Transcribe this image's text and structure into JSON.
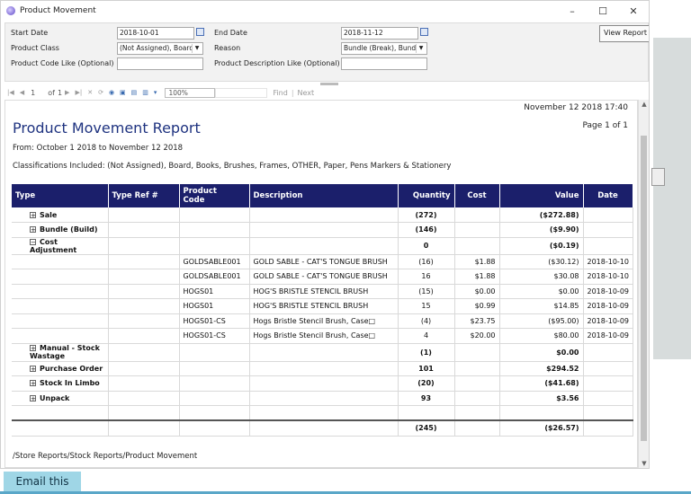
{
  "window": {
    "title": "Product Movement",
    "controls": {
      "minimize": "–",
      "maximize": "☐",
      "close": "✕"
    }
  },
  "params": {
    "start_date_label": "Start Date",
    "start_date_value": "2018-10-01",
    "end_date_label": "End Date",
    "end_date_value": "2018-11-12",
    "product_class_label": "Product Class",
    "product_class_value": "(Not Assigned), Board",
    "reason_label": "Reason",
    "reason_value": "Bundle (Break), Bundl",
    "code_like_label": "Product Code Like (Optional)",
    "code_like_value": "",
    "desc_like_label": "Product Description Like (Optional)",
    "desc_like_value": "",
    "view_report_label": "View Report"
  },
  "toolbar": {
    "page_current": "1",
    "page_of": "of",
    "page_total": "1",
    "zoom": "100%",
    "find_label": "Find",
    "separator": "|",
    "next_label": "Next"
  },
  "report": {
    "run_datetime": "November 12 2018 17:40",
    "title": "Product Movement Report",
    "page_info": "Page 1 of 1",
    "from_line": "From: October 1 2018 to November 12 2018",
    "classifications": "Classifications Included: (Not Assigned), Board, Books, Brushes, Frames, OTHER, Paper, Pens Markers & Stationery",
    "columns": {
      "type": "Type",
      "type_ref": "Type Ref #",
      "product_code_1": "Product",
      "product_code_2": "Code",
      "description": "Description",
      "quantity": "Quantity",
      "cost": "Cost",
      "value": "Value",
      "date": "Date"
    },
    "rows": [
      {
        "type": "Sale",
        "expander": "+",
        "qty": "(272)",
        "value": "($272.88)"
      },
      {
        "type": "Bundle (Build)",
        "expander": "+",
        "qty": "(146)",
        "value": "($9.90)"
      },
      {
        "type": "Cost Adjustment",
        "expander": "−",
        "qty": "0",
        "value": "($0.19)"
      },
      {
        "code": "GOLDSABLE001",
        "desc": "GOLD SABLE - CAT'S TONGUE BRUSH",
        "qty": "(16)",
        "cost": "$1.88",
        "value": "($30.12)",
        "date": "2018-10-10"
      },
      {
        "code": "GOLDSABLE001",
        "desc": "GOLD SABLE - CAT'S TONGUE BRUSH",
        "qty": "16",
        "cost": "$1.88",
        "value": "$30.08",
        "date": "2018-10-10"
      },
      {
        "code": "HOGS01",
        "desc": "HOG'S BRISTLE STENCIL BRUSH",
        "qty": "(15)",
        "cost": "$0.00",
        "value": "$0.00",
        "date": "2018-10-09"
      },
      {
        "code": "HOGS01",
        "desc": "HOG'S BRISTLE STENCIL BRUSH",
        "qty": "15",
        "cost": "$0.99",
        "value": "$14.85",
        "date": "2018-10-09"
      },
      {
        "code": "HOGS01-CS",
        "desc": "Hogs Bristle Stencil Brush, Case□",
        "qty": "(4)",
        "cost": "$23.75",
        "value": "($95.00)",
        "date": "2018-10-09"
      },
      {
        "code": "HOGS01-CS",
        "desc": "Hogs Bristle Stencil Brush, Case□",
        "qty": "4",
        "cost": "$20.00",
        "value": "$80.00",
        "date": "2018-10-09"
      },
      {
        "type": "Manual - Stock Wastage",
        "expander": "+",
        "qty": "(1)",
        "value": "$0.00"
      },
      {
        "type": "Purchase Order",
        "expander": "+",
        "qty": "101",
        "value": "$294.52"
      },
      {
        "type": "Stock In Limbo",
        "expander": "+",
        "qty": "(20)",
        "value": "($41.68)"
      },
      {
        "type": "Unpack",
        "expander": "+",
        "qty": "93",
        "value": "$3.56"
      }
    ],
    "total_qty": "(245)",
    "total_value": "($26.57)",
    "path": "/Store Reports/Stock Reports/Product Movement"
  },
  "email_button": "Email this",
  "colors": {
    "header_bg": "#1b1f6b",
    "title": "#1f3380",
    "email_bg": "#9fd6e6"
  }
}
